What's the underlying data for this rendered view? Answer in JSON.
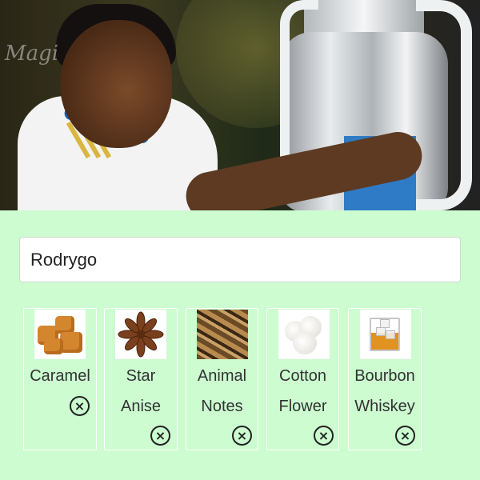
{
  "hero": {
    "watermark": "Magi"
  },
  "search": {
    "value": "Rodrygo"
  },
  "ingredients": [
    {
      "line1": "Caramel",
      "line2": "",
      "icon": "caramel-image"
    },
    {
      "line1": "Star",
      "line2": "Anise",
      "icon": "star-anise-image"
    },
    {
      "line1": "Animal",
      "line2": "Notes",
      "icon": "animal-notes-image"
    },
    {
      "line1": "Cotton",
      "line2": "Flower",
      "icon": "cotton-flower-image"
    },
    {
      "line1": "Bourbon",
      "line2": "Whiskey",
      "icon": "bourbon-whiskey-image"
    }
  ],
  "remove_glyph": "×",
  "colors": {
    "background": "#ccfcd0",
    "card_border": "#ffffff",
    "text": "#333333"
  }
}
